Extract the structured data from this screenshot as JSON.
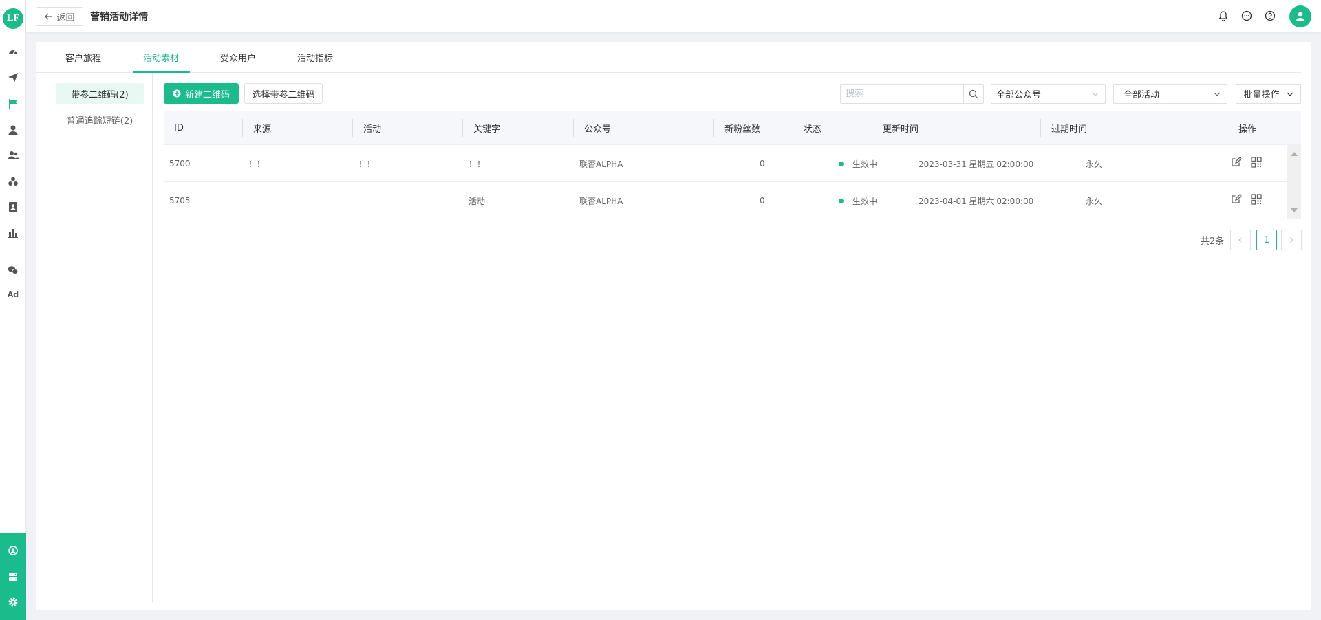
{
  "header": {
    "back_label": "返回",
    "title": "营销活动详情"
  },
  "tabs": [
    {
      "label": "客户旅程"
    },
    {
      "label": "活动素材"
    },
    {
      "label": "受众用户"
    },
    {
      "label": "活动指标"
    }
  ],
  "active_tab": "活动素材",
  "subnav": [
    {
      "label": "带参二维码(2)"
    },
    {
      "label": "普通追踪短链(2)"
    }
  ],
  "toolbar": {
    "new_qr_label": "新建二维码",
    "select_qr_label": "选择带参二维码",
    "search_placeholder": "搜索",
    "account_select": "全部公众号",
    "activity_select": "全部活动",
    "batch_label": "批量操作"
  },
  "table": {
    "columns": [
      "ID",
      "来源",
      "活动",
      "关键字",
      "公众号",
      "新粉丝数",
      "状态",
      "更新时间",
      "过期时间",
      "操作"
    ],
    "rows": [
      {
        "id": "5700",
        "source": "！！",
        "activity": "！！",
        "keyword": "！！",
        "account": "联否ALPHA",
        "new_fans": "0",
        "status": "生效中",
        "updated": "2023-03-31 星期五 02:00:00",
        "expires": "永久"
      },
      {
        "id": "5705",
        "source": "",
        "activity": "",
        "keyword": "活动",
        "account": "联否ALPHA",
        "new_fans": "0",
        "status": "生效中",
        "updated": "2023-04-01 星期六 02:00:00",
        "expires": "永久"
      }
    ]
  },
  "pagination": {
    "total_label": "共2条",
    "current_page": "1",
    "prev_icon": "chevron-left-icon",
    "next_icon": "chevron-right-icon"
  },
  "logo_text": "LF",
  "rail_ad_label": "Ad",
  "colors": {
    "accent": "#1abc8c",
    "active_bg": "#e8f8f3",
    "text": "#303133",
    "muted": "#606266"
  }
}
